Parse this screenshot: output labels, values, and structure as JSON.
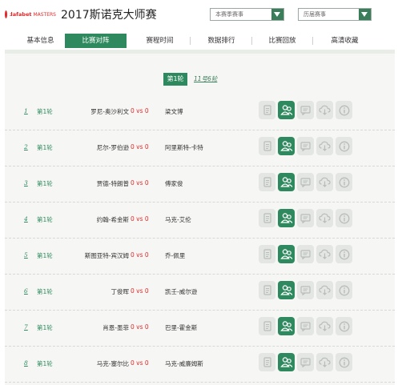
{
  "header": {
    "logo_text": "dafabet",
    "logo_sub": "MASTERS",
    "title": "2017斯诺克大师赛",
    "select_season": "本赛季赛事",
    "select_history": "历届赛事"
  },
  "tabs": [
    {
      "label": "基本信息"
    },
    {
      "label": "比赛对阵"
    },
    {
      "label": "赛程时间"
    },
    {
      "label": "数据排行"
    },
    {
      "label": "比赛回放"
    },
    {
      "label": "高清收藏"
    }
  ],
  "active_tab": "比赛对阵",
  "round": {
    "label": "第1轮",
    "date": "11号6轮"
  },
  "matches": [
    {
      "index": "1",
      "round": "第1轮",
      "player1": "罗尼-奥沙利文",
      "score": "0 vs 0",
      "player2": "梁文博"
    },
    {
      "index": "2",
      "round": "第1轮",
      "player1": "尼尔-罗伯逊",
      "score": "0 vs 0",
      "player2": "阿里斯特-卡特"
    },
    {
      "index": "3",
      "round": "第1轮",
      "player1": "贾德-特朗普",
      "score": "0 vs 0",
      "player2": "傅家俊"
    },
    {
      "index": "4",
      "round": "第1轮",
      "player1": "约翰-希金斯",
      "score": "0 vs 0",
      "player2": "马克-艾伦"
    },
    {
      "index": "5",
      "round": "第1轮",
      "player1": "斯图亚特-宾汉姆",
      "score": "0 vs 0",
      "player2": "乔-佩里"
    },
    {
      "index": "6",
      "round": "第1轮",
      "player1": "丁俊晖",
      "score": "0 vs 0",
      "player2": "凯壬-威尔逊"
    },
    {
      "index": "7",
      "round": "第1轮",
      "player1": "肖恩-墨菲",
      "score": "0 vs 0",
      "player2": "巴里-霍金斯"
    },
    {
      "index": "8",
      "round": "第1轮",
      "player1": "马克-塞尔比",
      "score": "0 vs 0",
      "player2": "马克-威廉姆斯"
    }
  ],
  "row_icons": [
    "document-icon",
    "players-icon",
    "chat-icon",
    "cloud-download-icon",
    "info-icon"
  ],
  "colors": {
    "accent": "#2e8a5e",
    "score": "#e0282a",
    "icon_bg": "#e4e6e3"
  }
}
